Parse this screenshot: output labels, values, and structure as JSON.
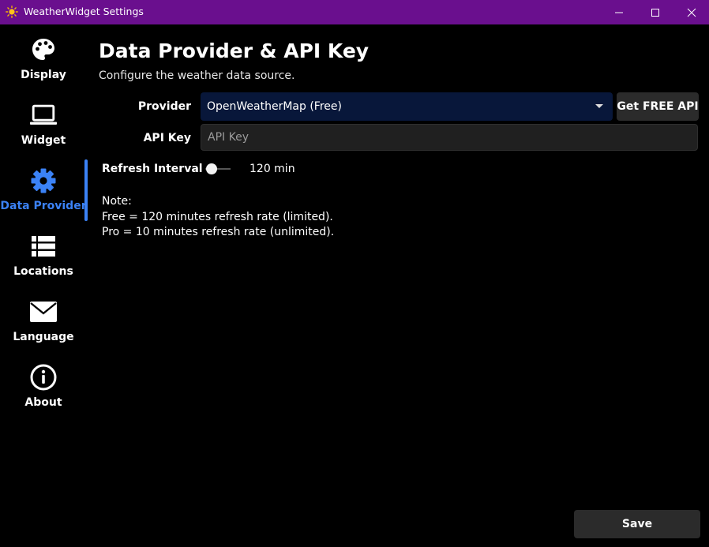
{
  "window": {
    "title": "WeatherWidget Settings",
    "icon": "sun-icon",
    "accent": "#6a0f8e"
  },
  "sidebar": {
    "items": [
      {
        "label": "Display",
        "icon": "palette-icon",
        "active": false
      },
      {
        "label": "Widget",
        "icon": "laptop-icon",
        "active": false
      },
      {
        "label": "Data Provider",
        "icon": "gear-icon",
        "active": true
      },
      {
        "label": "Locations",
        "icon": "list-icon",
        "active": false
      },
      {
        "label": "Language",
        "icon": "envelope-icon",
        "active": false
      },
      {
        "label": "About",
        "icon": "info-icon",
        "active": false
      }
    ],
    "active_color": "#3b82f6"
  },
  "main": {
    "title": "Data Provider & API Key",
    "subtitle": "Configure the weather data source.",
    "provider": {
      "label": "Provider",
      "selected": "OpenWeatherMap (Free)",
      "get_api_label": "Get FREE API"
    },
    "api_key": {
      "label": "API Key",
      "value": "",
      "placeholder": "API Key"
    },
    "refresh": {
      "label": "Refresh Interval",
      "value_text": "120 min"
    },
    "note": {
      "line1": "Note:",
      "line2": "Free = 120 minutes refresh rate (limited).",
      "line3": "Pro = 10 minutes refresh rate (unlimited)."
    },
    "save_label": "Save"
  }
}
